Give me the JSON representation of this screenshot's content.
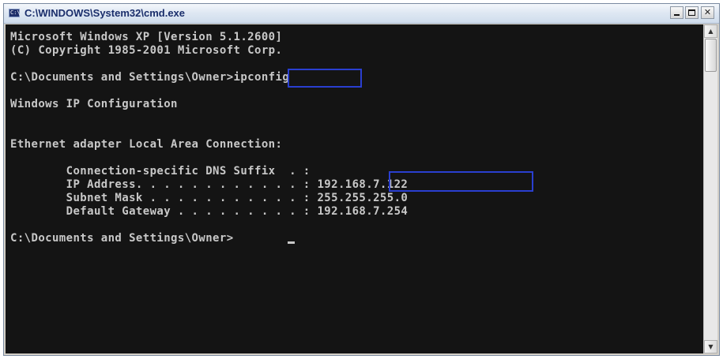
{
  "window": {
    "title": "C:\\WINDOWS\\System32\\cmd.exe",
    "icon_label": "C:\\",
    "buttons": {
      "minimize": "minimize-icon",
      "maximize": "maximize-icon",
      "close_label": "✕"
    }
  },
  "console": {
    "lines": [
      "Microsoft Windows XP [Version 5.1.2600]",
      "(C) Copyright 1985-2001 Microsoft Corp.",
      "",
      "C:\\Documents and Settings\\Owner>ipconfig",
      "",
      "Windows IP Configuration",
      "",
      "",
      "Ethernet adapter Local Area Connection:",
      "",
      "        Connection-specific DNS Suffix  . :",
      "        IP Address. . . . . . . . . . . . : 192.168.7.122",
      "        Subnet Mask . . . . . . . . . . . : 255.255.255.0",
      "        Default Gateway . . . . . . . . . : 192.168.7.254",
      "",
      "C:\\Documents and Settings\\Owner>"
    ],
    "highlights": [
      "ipconfig",
      "192.168.7.122"
    ]
  },
  "scrollbar": {
    "up_label": "▲",
    "down_label": "▼"
  },
  "colors": {
    "console_bg": "#141414",
    "console_text": "#c8c8c8",
    "highlight_box": "#2a3fd0",
    "title_text": "#1a2e6b"
  }
}
